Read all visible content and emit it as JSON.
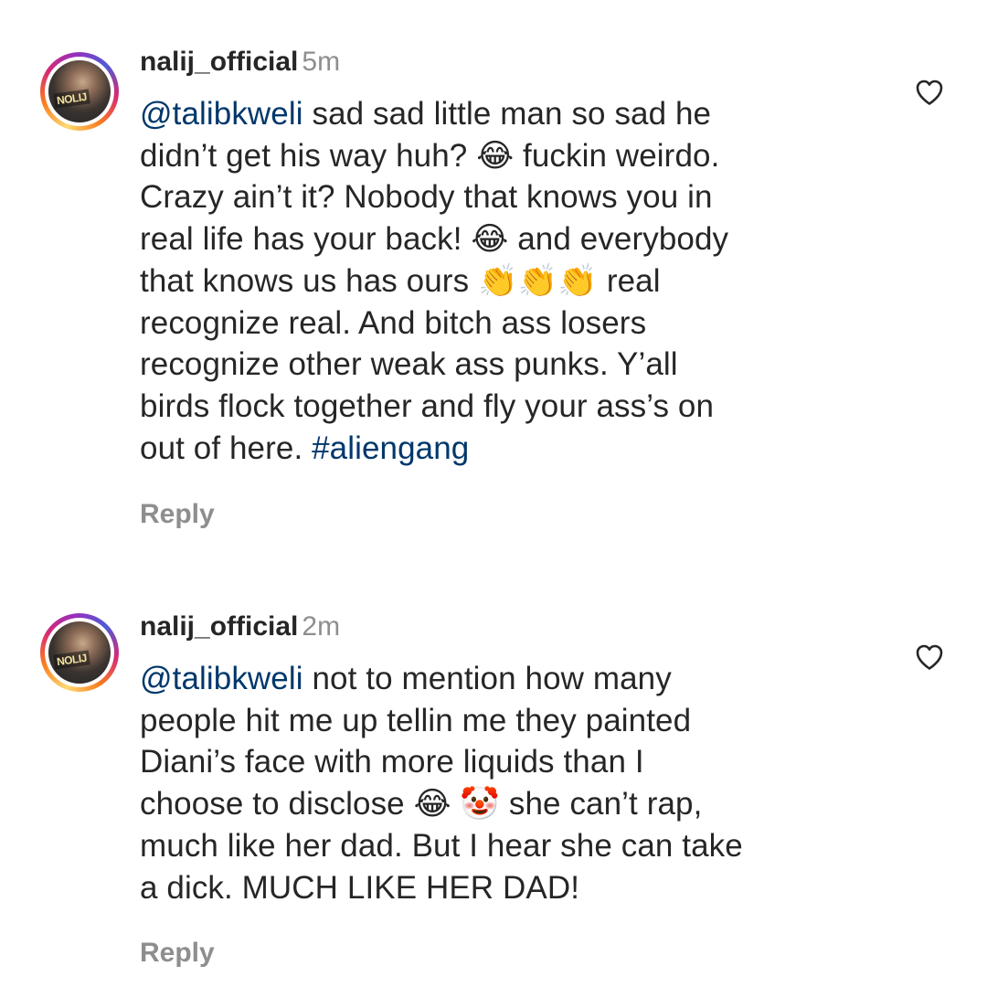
{
  "comments": [
    {
      "avatar_text": "NOLIJ",
      "username": "nalij_official",
      "time": "5m",
      "lines": [
        [
          {
            "t": "@talibkweli",
            "k": "mention"
          },
          {
            "t": " sad sad little man so sad he"
          }
        ],
        [
          {
            "t": "didn’t get his way huh? 😂 fuckin weirdo."
          }
        ],
        [
          {
            "t": "Crazy ain’t it? Nobody that knows you in"
          }
        ],
        [
          {
            "t": "real life has your back! 😂 and everybody"
          }
        ],
        [
          {
            "t": "that knows us has ours 👏👏👏 real"
          }
        ],
        [
          {
            "t": "recognize real. And bitch ass losers"
          }
        ],
        [
          {
            "t": "recognize other weak ass punks. Y’all"
          }
        ],
        [
          {
            "t": "birds flock together and fly your ass’s on"
          }
        ],
        [
          {
            "t": "out of here. "
          },
          {
            "t": "#aliengang",
            "k": "hashtag"
          }
        ]
      ],
      "reply_label": "Reply",
      "like_icon": "heart-outline-icon"
    },
    {
      "avatar_text": "NOLIJ",
      "username": "nalij_official",
      "time": "2m",
      "lines": [
        [
          {
            "t": "@talibkweli",
            "k": "mention"
          },
          {
            "t": " not to mention how many"
          }
        ],
        [
          {
            "t": "people hit me up tellin me they painted"
          }
        ],
        [
          {
            "t": "Diani’s face with more liquids than I"
          }
        ],
        [
          {
            "t": "choose to disclose 😂 🤡 she can’t rap,"
          }
        ],
        [
          {
            "t": "much like her dad. But I hear she can take"
          }
        ],
        [
          {
            "t": "a dick. MUCH LIKE HER DAD!"
          }
        ]
      ],
      "reply_label": "Reply",
      "like_icon": "heart-outline-icon"
    }
  ],
  "colors": {
    "text": "#262626",
    "link": "#00376b",
    "muted": "#8e8e8e",
    "background": "#ffffff"
  }
}
